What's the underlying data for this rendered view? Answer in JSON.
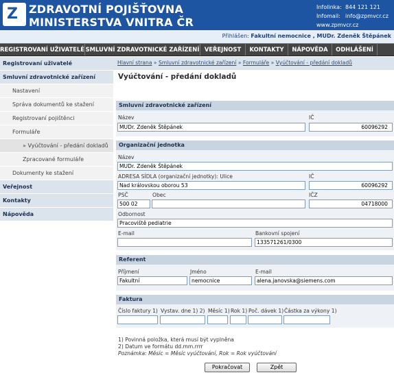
{
  "header": {
    "org_line1": "ZDRAVOTNÍ  POJIŠŤOVNA",
    "org_line2": "MINISTERSTVA VNITRA ČR",
    "logo_letter": "Z",
    "infolinka_label": "Infolinka:",
    "infolinka_value": "844 121 121",
    "infomail_label": "Infomail:",
    "infomail_value": "info@zpmvcr.cz",
    "web": "www.zpmvcr.cz",
    "login_label": "Přihlášen:",
    "login_user": "Fakultní nemocnice , MUDr. Zdeněk Štěpánek"
  },
  "topnav": [
    "REGISTROVANÍ UŽIVATELÉ",
    "SMLUVNÍ ZDRAVOTNICKÉ ZAŘÍZENÍ",
    "VEŘEJNOST",
    "KONTAKTY",
    "NÁPOVĚDA",
    "ODHLÁŠENÍ"
  ],
  "sidebar": [
    "Registrovaní uživatelé",
    "Smluvní zdravotnické zařízení",
    "Nastavení",
    "Správa dokumentů ke stažení",
    "Registrovaní pojištěnci",
    "Formuláře",
    "» Vyúčtování - předání dokladů",
    "Zpracované formuláře",
    "Dokumenty ke stažení",
    "Veřejnost",
    "Kontakty",
    "Nápověda"
  ],
  "breadcrumb": {
    "home": "Hlavní strana",
    "sep": " » ",
    "level2": "Smluvní zdravotnické zařízení",
    "level3": "Formuláře",
    "level4": "Vyúčtování - předání dokladů"
  },
  "page_title": "Vyúčtování - předání dokladů",
  "szz": {
    "section": "Smluvní zdravotnické zařízení",
    "name_label": "Název",
    "name_value": "MUDr. Zdeněk Štěpánek",
    "ic_label": "IČ",
    "ic_value": "60096292"
  },
  "org": {
    "section": "Organizační jednotka",
    "name_label": "Název",
    "name_value": "MUDr. Zdeněk Štěpánek",
    "address_label": "ADRESA SÍDLA (organizační jednotky): Ulice",
    "address_value": "Nad královskou oborou 53",
    "ic_label": "IČ",
    "ic_value": "60096292",
    "psc_label": "PSČ",
    "psc_value": "500 02",
    "obec_label": "Obec",
    "obec_value": "",
    "icz_label": "IČZ",
    "icz_value": "04718000",
    "odbornost_label": "Odbornost",
    "odbornost_value": "Pracoviště pediatrie",
    "email_label": "E-mail",
    "email_value": "",
    "bank_label": "Bankovní spojení",
    "bank_value": "133571261/0300"
  },
  "referent": {
    "section": "Referent",
    "surname_label": "Příjmení",
    "surname_value": "Fakultní",
    "firstname_label": "Jméno",
    "firstname_value": "nemocnice",
    "email_label": "E-mail",
    "email_value": "alena.janovska@siemens.com"
  },
  "faktura": {
    "section": "Faktura",
    "cislo_label": "Číslo faktury 1)",
    "vystav_label": "Vystav. dne 1) 2)",
    "mesic_label": "Měsíc 1)",
    "rok_label": "Rok 1)",
    "davek_label": "Poč. dávek 1)",
    "castka_label": "Částka za výkony 1)",
    "cislo_value": "",
    "vystav_value": "",
    "mesic_value": "",
    "rok_value": "",
    "davek_value": "",
    "castka_value": ""
  },
  "notes": {
    "note1": "1) Povinná položka, která musí být vyplněna",
    "note2": "2) Datum ve formátu dd.mm.rrrr",
    "note3": "Poznámka: Měsíc = Měsíc vyúčtování, Rok = Rok vyúčtování"
  },
  "buttons": {
    "continue": "Pokračovat",
    "back": "Zpět"
  },
  "colors": {
    "header_blue": "#1d55a2",
    "nav_dark": "#444444",
    "section_bar": "#c8d4e0",
    "sidebar_highlight": "#dbe3ec"
  }
}
